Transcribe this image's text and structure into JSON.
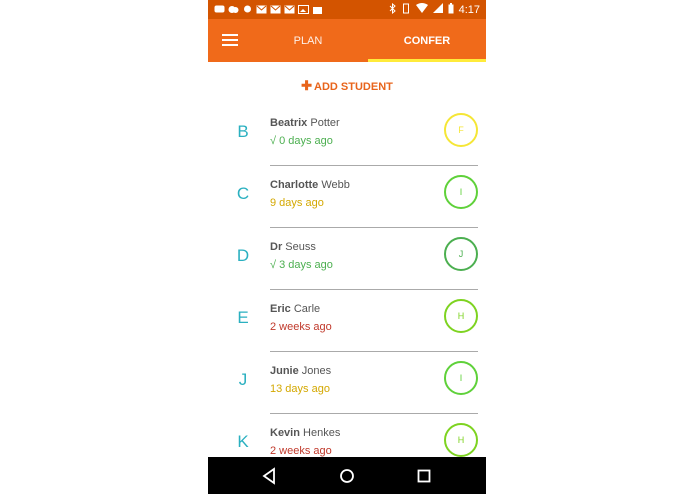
{
  "status_bar": {
    "time": "4:17"
  },
  "app_bar": {
    "tabs": [
      {
        "label": "PLAN",
        "active": false
      },
      {
        "label": "CONFER",
        "active": true
      }
    ],
    "colors": {
      "bar": "#f06a1a",
      "status": "#d35400",
      "indicator": "#ffeb3b"
    }
  },
  "add_student": {
    "label": "ADD STUDENT",
    "icon": "plus-icon"
  },
  "students": [
    {
      "letter": "B",
      "first": "Beatrix",
      "last": "Potter",
      "time": "√ 0 days ago",
      "time_color": "#4caf50",
      "badge": "F",
      "badge_color": "#f5e636"
    },
    {
      "letter": "C",
      "first": "Charlotte",
      "last": "Webb",
      "time": "9 days ago",
      "time_color": "#d4a800",
      "badge": "I",
      "badge_color": "#5fd13a"
    },
    {
      "letter": "D",
      "first": "Dr",
      "last": "Seuss",
      "time": "√ 3 days ago",
      "time_color": "#4caf50",
      "badge": "J",
      "badge_color": "#4caf50"
    },
    {
      "letter": "E",
      "first": "Eric",
      "last": "Carle",
      "time": "2 weeks ago",
      "time_color": "#c0392b",
      "badge": "H",
      "badge_color": "#7ed321"
    },
    {
      "letter": "J",
      "first": "Junie",
      "last": "Jones",
      "time": "13 days ago",
      "time_color": "#d4a800",
      "badge": "I",
      "badge_color": "#5fd13a"
    },
    {
      "letter": "K",
      "first": "Kevin",
      "last": "Henkes",
      "time": "2 weeks ago",
      "time_color": "#c0392b",
      "badge": "H",
      "badge_color": "#7ed321"
    }
  ],
  "nav": {
    "back_icon": "back-icon",
    "home_icon": "home-icon",
    "recents_icon": "recents-icon"
  }
}
